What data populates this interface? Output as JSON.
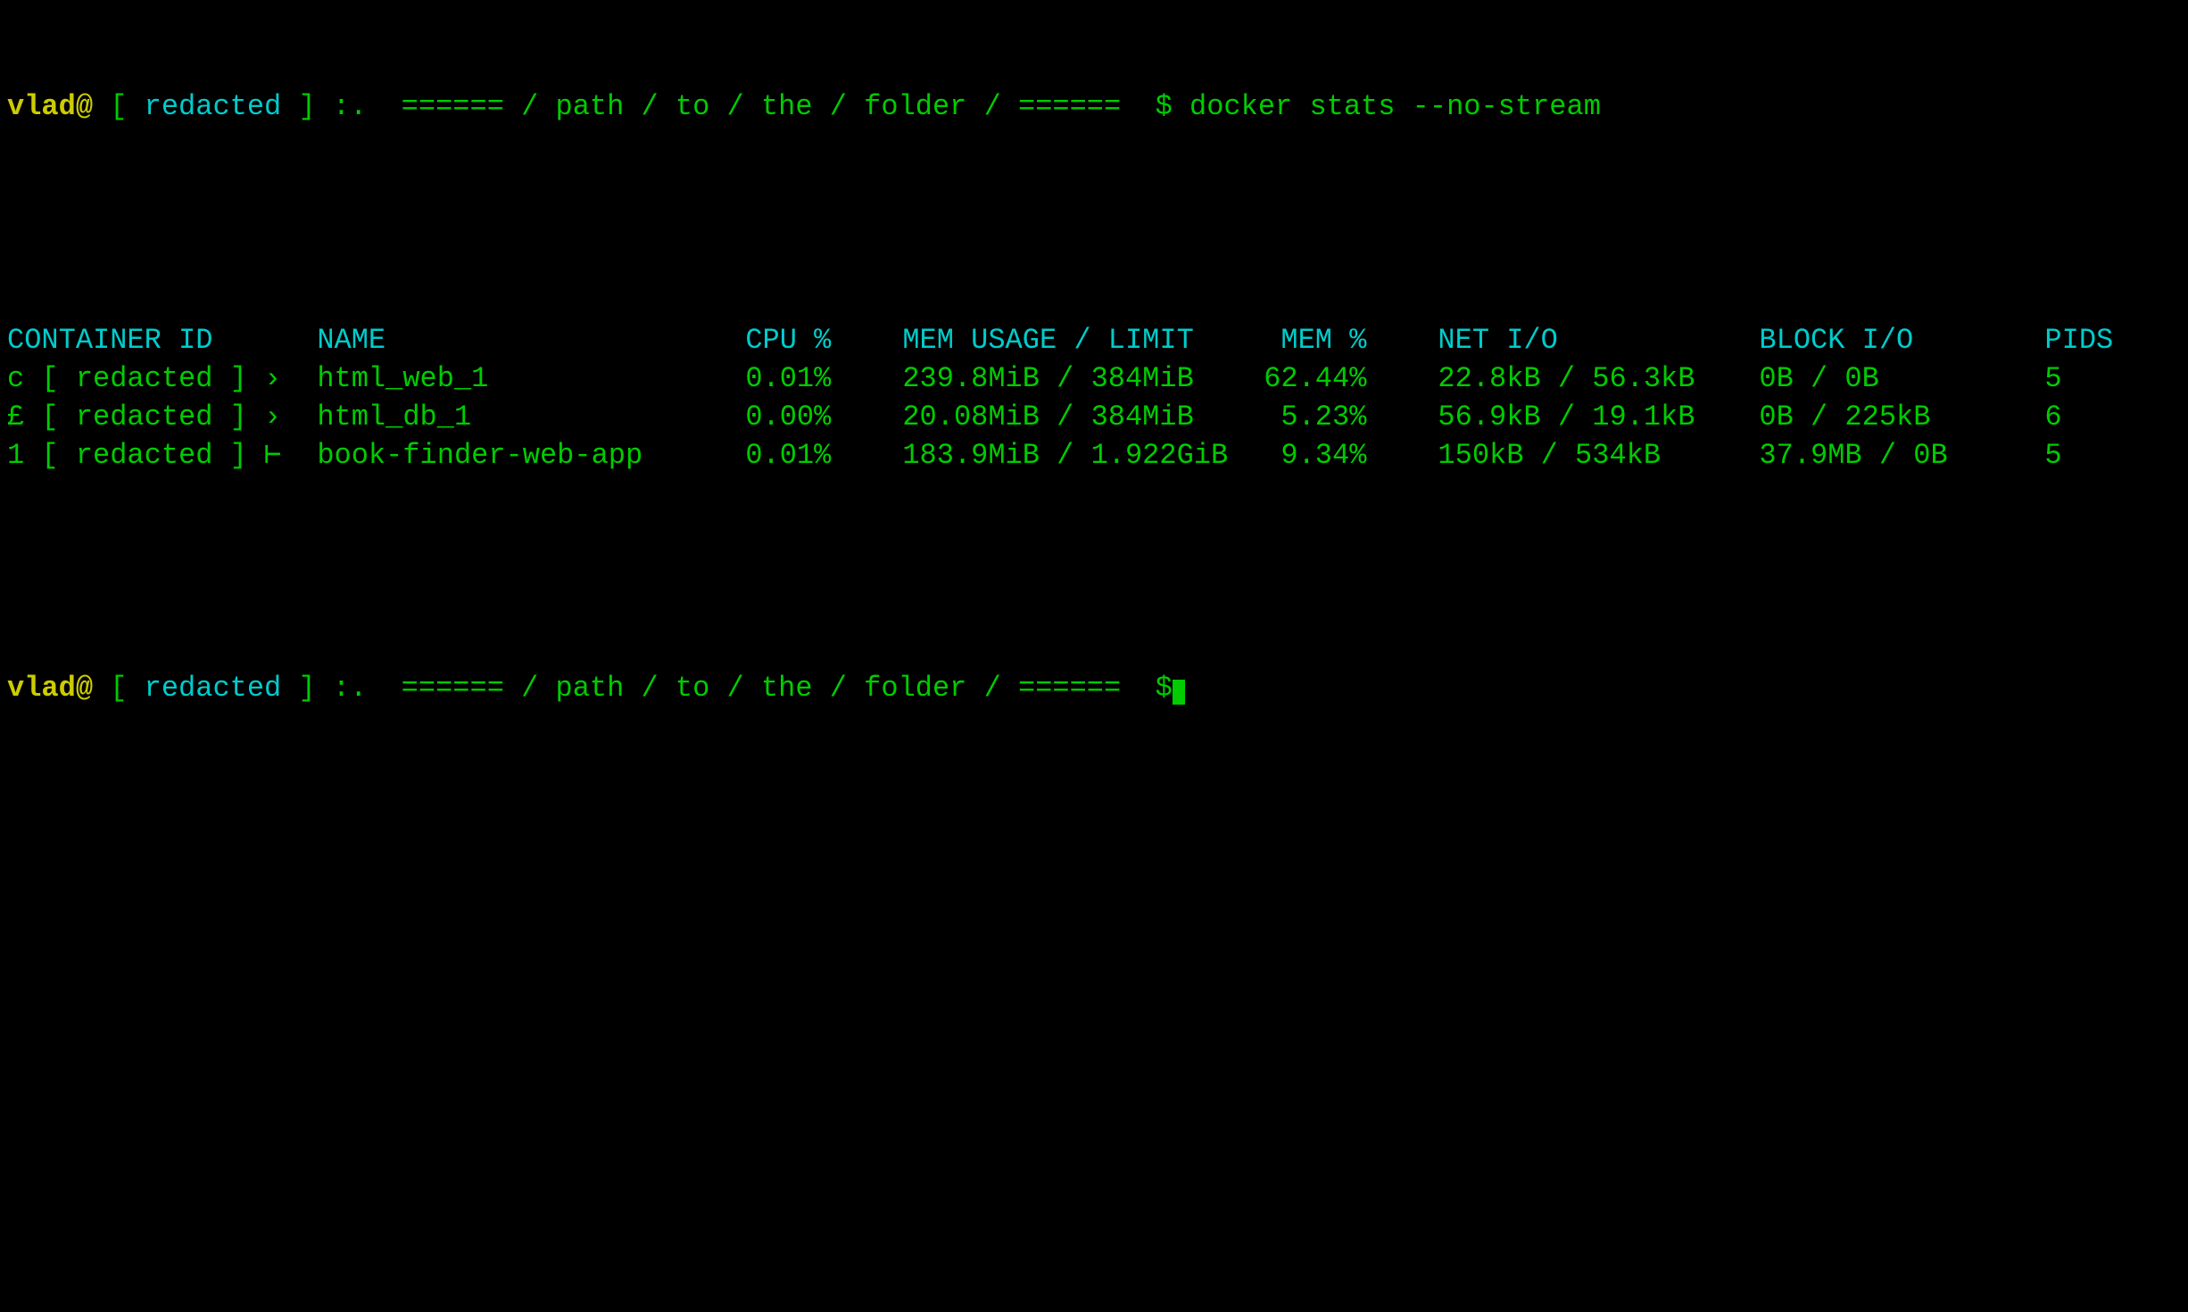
{
  "terminal": {
    "prompt_user": "vlad@",
    "prompt_bracket_open": " [ ",
    "prompt_redacted_1": "redacted",
    "prompt_bracket_close": " ] ",
    "prompt_path_prefix": ":.",
    "prompt_path": "  ====== / path / to / the / folder / ======",
    "prompt_dollar": "  $",
    "command": " docker stats --no-stream",
    "header": {
      "container_id": "CONTAINER ID",
      "name": "NAME",
      "cpu": "CPU %",
      "mem_usage": "MEM USAGE / LIMIT",
      "mem_pct": "MEM %",
      "net_io": "NET I/O",
      "block_io": "BLOCK I/O",
      "pids": "PIDS"
    },
    "rows": [
      {
        "container_id": "c [ redacted ]",
        "id_suffix": " ›",
        "name": "html_web_1",
        "cpu": "0.01%",
        "mem_usage": "239.8MiB / 384MiB",
        "mem_pct": "62.44%",
        "net_io": "22.8kB / 56.3kB",
        "block_io": "0B / 0B",
        "pids": "5"
      },
      {
        "container_id": "£ [ redacted ]",
        "id_suffix": " ›",
        "name": "html_db_1",
        "cpu": "0.00%",
        "mem_usage": "20.08MiB / 384MiB",
        "mem_pct": "5.23%",
        "net_io": "56.9kB / 19.1kB",
        "block_io": "0B / 225kB",
        "pids": "6"
      },
      {
        "container_id": "1 [ redacted ]",
        "id_suffix": " ⊢",
        "name": "book-finder-web-app",
        "cpu": "0.01%",
        "mem_usage": "183.9MiB / 1.922GiB",
        "mem_pct": "9.34%",
        "net_io": "150kB / 534kB",
        "block_io": "37.9MB / 0B",
        "pids": "5"
      }
    ],
    "prompt2_user": "vlad@",
    "prompt2_bracket_open": " [ ",
    "prompt2_redacted": "redacted",
    "prompt2_bracket_close": " ] ",
    "prompt2_path_prefix": ":.",
    "prompt2_path": "  ====== / path / to / the / folder / ======",
    "prompt2_dollar": "  $"
  }
}
